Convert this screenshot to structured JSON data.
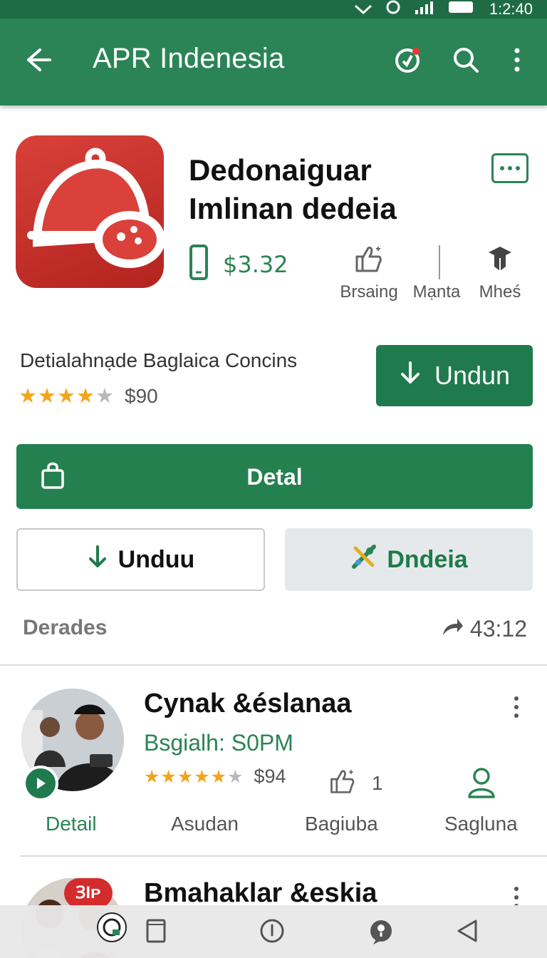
{
  "status_bar": {
    "time": "1:2:40"
  },
  "app_bar": {
    "title": "APR Indenesia",
    "icons": [
      "back-arrow-icon",
      "notification-badge-icon",
      "search-icon",
      "more-vert-icon"
    ],
    "color": "#2a8455"
  },
  "app": {
    "name": "Dedonaiguar Imlinan dedeia",
    "icon": "bell-chat-icon",
    "price": "$3.32",
    "stats": [
      {
        "label": "Brsaing",
        "icon": "thumbs-up-icon"
      },
      {
        "label": "Mạnta",
        "icon": "divider-icon"
      },
      {
        "label": "Mheś",
        "icon": "graduation-cap-icon"
      }
    ],
    "description": "Detialahnạde Baglaica Concins",
    "rating": 4,
    "rating_price": "$90",
    "install_label": "Undun"
  },
  "buttons": {
    "detail_label": "Detal",
    "secondary_label": "Unduu",
    "tertiary_label": "Dndeia"
  },
  "section": {
    "label": "Derades",
    "time": "43:12"
  },
  "cards": [
    {
      "title": "Cynak &éslanaa",
      "subtitle": "Bsgialh: S0PM",
      "rating": 4.5,
      "rating_price": "$94",
      "like_count": "1",
      "actions": [
        "Detail",
        "Asudan",
        "Bagiuba",
        "Sagluna"
      ]
    },
    {
      "title": "Bmahaklar &eskia",
      "badge": "ꞫIᴘ"
    }
  ],
  "accent_color": "#2a8455"
}
